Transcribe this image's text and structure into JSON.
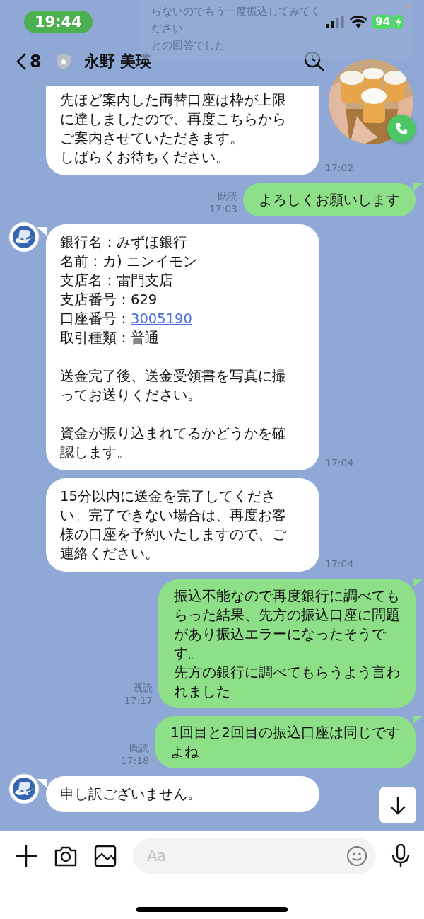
{
  "status_bar": {
    "time": "19:44",
    "battery": "94"
  },
  "notification": {
    "lines": [
      "らないのでもう一度振込してみてく",
      "ださい",
      "との回答でした"
    ]
  },
  "header": {
    "back_count": "8",
    "title": "永野 美瑛"
  },
  "messages": [
    {
      "kind": "in",
      "avatar": false,
      "tail": false,
      "paragraphs": [
        [
          {
            "text": "先ほど案内した両替口座は枠が上限"
          },
          {
            "text": "に達しましたので、再度こちらから"
          },
          {
            "text": "ご案内させていただきます。"
          },
          {
            "text": "しばらくお待ちください。"
          }
        ]
      ],
      "time": "17:02"
    },
    {
      "kind": "out",
      "tail": true,
      "read_label": "既読",
      "paragraphs": [
        [
          {
            "text": "よろしくお願いします"
          }
        ]
      ],
      "time": "17:03"
    },
    {
      "kind": "in",
      "avatar": true,
      "tail": true,
      "paragraphs": [
        [
          {
            "text": "銀行名：みずほ銀行"
          },
          {
            "text": "名前：カ) ニンイモン"
          },
          {
            "text": "支店名：雷門支店"
          },
          {
            "text": "支店番号：629"
          },
          {
            "text": "口座番号：",
            "link": "3005190"
          },
          {
            "text": "取引種類：普通"
          }
        ],
        [
          {
            "text": "送金完了後、送金受領書を写真に撮"
          },
          {
            "text": "ってお送りください。"
          }
        ],
        [
          {
            "text": "資金が振り込まれてるかどうかを確"
          },
          {
            "text": "認します。"
          }
        ]
      ],
      "time": "17:04"
    },
    {
      "kind": "in",
      "avatar": false,
      "tail": false,
      "paragraphs": [
        [
          {
            "text": "15分以内に送金を完了してくださ"
          },
          {
            "text": "い。完了できない場合は、再度お客"
          },
          {
            "text": "様の口座を予約いたしますので、ご"
          },
          {
            "text": "連絡ください。"
          }
        ]
      ],
      "time": "17:04"
    },
    {
      "kind": "out",
      "tail": true,
      "read_label": "既読",
      "paragraphs": [
        [
          {
            "text": "振込不能なので再度銀行に調べても"
          },
          {
            "text": "らった結果、先方の振込口座に問題"
          },
          {
            "text": "があり振込エラーになったそうで"
          },
          {
            "text": "す。"
          },
          {
            "text": "先方の銀行に調べてもらうよう言わ"
          },
          {
            "text": "れました"
          }
        ]
      ],
      "time": "17:17"
    },
    {
      "kind": "out",
      "tail": true,
      "read_label": "既読",
      "paragraphs": [
        [
          {
            "text": "1回目と2回目の振込口座は同じです"
          },
          {
            "text": "よね"
          }
        ]
      ],
      "time": "17:18"
    },
    {
      "kind": "in",
      "avatar": true,
      "tail": true,
      "paragraphs": [
        [
          {
            "text": "申し訳ございません。"
          }
        ]
      ]
    }
  ],
  "input": {
    "placeholder": "Aa"
  }
}
